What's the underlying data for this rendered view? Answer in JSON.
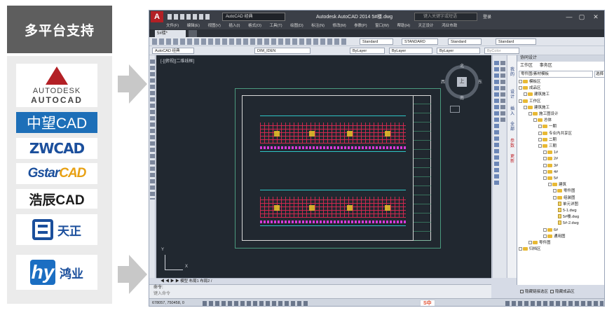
{
  "left_panel": {
    "heading": "多平台支持",
    "brands": {
      "autodesk_line1": "AUTODESK",
      "autodesk_line2": "AUTOCAD",
      "zwcad_cn": "中望CAD",
      "zwcad": "ZWCAD",
      "gstar_prefix": "Gstar",
      "gstar_suffix": "CAD",
      "haochen": "浩辰CAD",
      "tianzheng": "天正",
      "hongye_mark": "hy",
      "hongye": "鸿业"
    }
  },
  "cad": {
    "app_icon": "A",
    "workspace": "AutoCAD 经典",
    "title": "Autodesk AutoCAD 2014    5#楼.dwg",
    "search_placeholder": "键入关键字或短语",
    "login": "登录",
    "win_min": "—",
    "win_max": "▢",
    "win_close": "✕",
    "menus": [
      "文件(F)",
      "编辑(E)",
      "视图(V)",
      "插入(I)",
      "格式(O)",
      "工具(T)",
      "绘图(D)",
      "标注(N)",
      "修改(M)",
      "参数(P)",
      "窗口(W)",
      "帮助(H)",
      "天正设计",
      "鸿业市政"
    ],
    "doc_tab": "5#楼*",
    "toolbar": {
      "text_style": "Standard",
      "dim_style": "STANDARD",
      "table_style": "Standard",
      "mleader_style": "Standard",
      "workspace2": "AutoCAD 经典",
      "layer": "DIM_IDEN",
      "color": "ByLayer",
      "linetype": "ByLayer",
      "lineweight": "ByLayer",
      "plotstyle": "ByColor"
    },
    "viewport_label": "[-][俯视][二维线框]",
    "viewcube": {
      "top": "上",
      "north": "北",
      "south": "南",
      "west": "西",
      "east": "东",
      "wcs": "WCS"
    },
    "ucs": {
      "x": "X",
      "y": "Y"
    },
    "layout_tabs": "◀ ◀ ▶ ▶  模型  布局1  布局2  /",
    "cmd_history": "命令:",
    "cmd_prompt": "键入命令",
    "status_coords": "678057, 750458, 0",
    "ime": "S中",
    "side_strip": [
      "我的",
      "设计",
      "插入",
      "全部",
      "参数",
      "更新"
    ],
    "tz_panel": {
      "title": "协同设计",
      "tabs": [
        "工作区",
        "事务区"
      ],
      "filter": "零件图/素材模板",
      "select": "选择",
      "tree": [
        {
          "label": "模板区",
          "depth": 0,
          "kind": "folder"
        },
        {
          "label": "成品区",
          "depth": 0,
          "kind": "folder"
        },
        {
          "label": "建筑施工",
          "depth": 1,
          "kind": "folder"
        },
        {
          "label": "工作区",
          "depth": 0,
          "kind": "folder"
        },
        {
          "label": "建筑施工",
          "depth": 1,
          "kind": "folder"
        },
        {
          "label": "施工图设计",
          "depth": 2,
          "kind": "folder"
        },
        {
          "label": "总体",
          "depth": 3,
          "kind": "folder"
        },
        {
          "label": "一期",
          "depth": 4,
          "kind": "folder"
        },
        {
          "label": "专业内共享区",
          "depth": 4,
          "kind": "folder"
        },
        {
          "label": "二期",
          "depth": 4,
          "kind": "folder"
        },
        {
          "label": "三期",
          "depth": 4,
          "kind": "folder"
        },
        {
          "label": "1#",
          "depth": 5,
          "kind": "folder"
        },
        {
          "label": "2#",
          "depth": 5,
          "kind": "folder"
        },
        {
          "label": "3#",
          "depth": 5,
          "kind": "folder"
        },
        {
          "label": "4#",
          "depth": 5,
          "kind": "folder"
        },
        {
          "label": "5#",
          "depth": 5,
          "kind": "folder"
        },
        {
          "label": "建筑",
          "depth": 6,
          "kind": "folder"
        },
        {
          "label": "零件图",
          "depth": 7,
          "kind": "folder"
        },
        {
          "label": "组装图",
          "depth": 7,
          "kind": "folder"
        },
        {
          "label": "单元详图",
          "depth": 8,
          "kind": "file"
        },
        {
          "label": "5-1.dwg",
          "depth": 8,
          "kind": "file"
        },
        {
          "label": "5#楼.dwg",
          "depth": 8,
          "kind": "file"
        },
        {
          "label": "5#-2.dwg",
          "depth": 8,
          "kind": "file"
        },
        {
          "label": "6#",
          "depth": 5,
          "kind": "folder"
        },
        {
          "label": "通用图",
          "depth": 5,
          "kind": "folder"
        },
        {
          "label": "零件图",
          "depth": 2,
          "kind": "folder"
        },
        {
          "label": "归档区",
          "depth": 0,
          "kind": "folder"
        }
      ],
      "check1": "隐藏链接选区",
      "check2": "隐藏成品区"
    }
  }
}
